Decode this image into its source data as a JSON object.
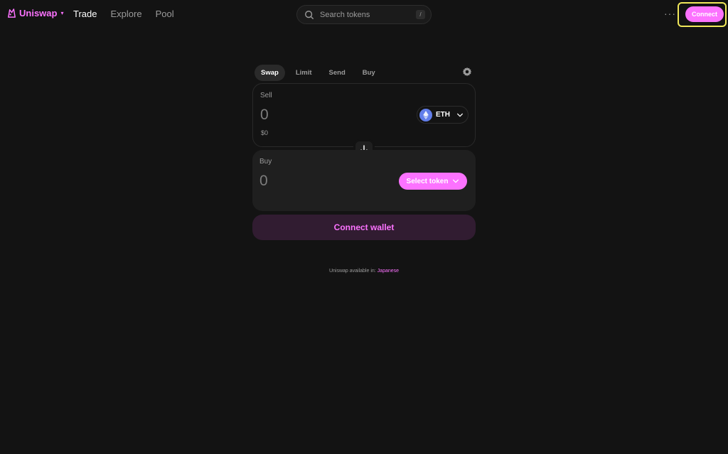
{
  "brand": {
    "name": "Uniswap",
    "caret": "▾",
    "logo_icon": "unicorn-logo-icon"
  },
  "nav": {
    "links": [
      {
        "label": "Trade",
        "active": true
      },
      {
        "label": "Explore",
        "active": false
      },
      {
        "label": "Pool",
        "active": false
      }
    ]
  },
  "search": {
    "placeholder": "Search tokens",
    "shortcut": "/"
  },
  "header": {
    "more_label": "···",
    "connect_label": "Connect"
  },
  "swap": {
    "tabs": [
      {
        "label": "Swap",
        "active": true
      },
      {
        "label": "Limit",
        "active": false
      },
      {
        "label": "Send",
        "active": false
      },
      {
        "label": "Buy",
        "active": false
      }
    ],
    "sell": {
      "label": "Sell",
      "amount": "0",
      "usd_value": "$0",
      "token_symbol": "ETH"
    },
    "buy": {
      "label": "Buy",
      "amount": "0",
      "select_token_label": "Select token"
    },
    "connect_wallet_label": "Connect wallet"
  },
  "footer": {
    "available_text": "Uniswap available in:",
    "language_link": "Japanese"
  },
  "colors": {
    "accent": "#fc72ff",
    "background": "#131313",
    "panel": "#1f1f1f",
    "eth": "#627eea",
    "highlight": "#f1e85a"
  }
}
